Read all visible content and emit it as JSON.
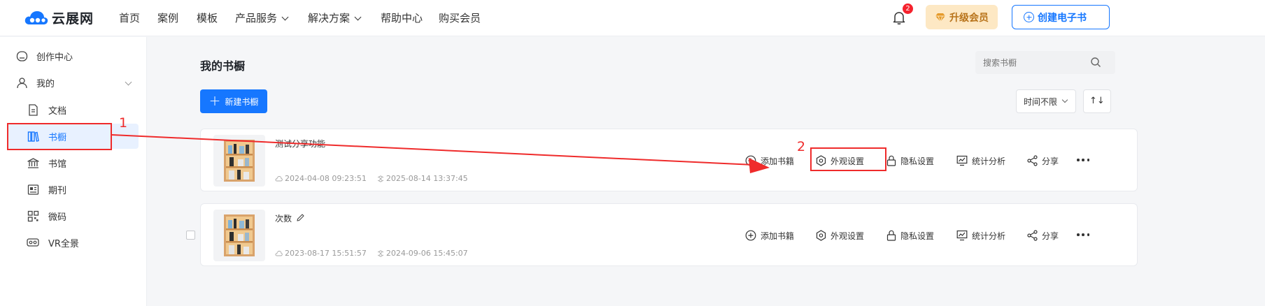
{
  "header": {
    "logo_text": "云展网",
    "nav": [
      {
        "label": "首页"
      },
      {
        "label": "案例"
      },
      {
        "label": "模板"
      },
      {
        "label": "产品服务"
      },
      {
        "label": "解决方案"
      },
      {
        "label": "帮助中心"
      },
      {
        "label": "购买会员"
      }
    ],
    "notification_count": "2",
    "vip_label": "升级会员",
    "create_label": "创建电子书"
  },
  "sidebar": {
    "items": [
      {
        "label": "创作中心",
        "icon": "home-icon"
      },
      {
        "label": "我的",
        "icon": "user-icon"
      },
      {
        "label": "文档",
        "icon": "document-icon"
      },
      {
        "label": "书橱",
        "icon": "bookshelf-icon",
        "active": true
      },
      {
        "label": "书馆",
        "icon": "library-icon"
      },
      {
        "label": "期刊",
        "icon": "journal-icon"
      },
      {
        "label": "微码",
        "icon": "qrcode-icon"
      },
      {
        "label": "VR全景",
        "icon": "vr-icon"
      }
    ]
  },
  "main": {
    "title": "我的书橱",
    "search_placeholder": "搜索书橱",
    "new_button": "新建书橱",
    "time_filter": "时间不限",
    "sort_label": "↑↓",
    "actions": [
      "添加书籍",
      "外观设置",
      "隐私设置",
      "统计分析",
      "分享"
    ],
    "shelves": [
      {
        "name": "测试分享功能",
        "created": "2024-04-08 09:23:51",
        "updated": "2025-08-14 13:37:45"
      },
      {
        "name": "次数",
        "created": "2023-08-17 15:51:57",
        "updated": "2024-09-06 15:45:07"
      }
    ]
  },
  "annotations": {
    "step1": "1",
    "step2": "2",
    "color": "#ef2b2b"
  },
  "colors": {
    "primary": "#1677ff",
    "vip_bg": "#fde8c4",
    "vip_text": "#b8731a",
    "badge": "#f5222d"
  }
}
